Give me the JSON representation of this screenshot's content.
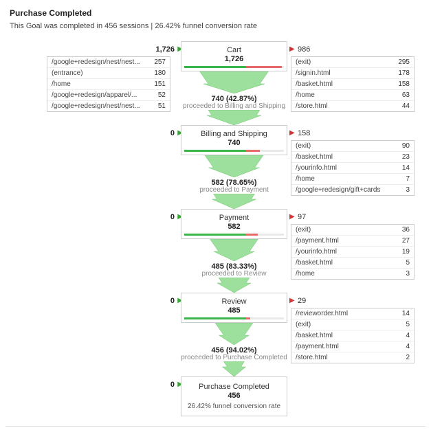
{
  "header": {
    "title": "Purchase Completed",
    "subtitle": "This Goal was completed in 456 sessions | 26.42% funnel conversion rate"
  },
  "steps": [
    {
      "name": "Cart",
      "count": "1,726",
      "in_count": "1,726",
      "out_count": "986",
      "bar_green_pct": 62,
      "bar_red_pct": 36,
      "proceeded_count": "740 (42.87%)",
      "proceeded_label": "proceeded to Billing and Shipping",
      "in_rows": [
        {
          "path": "/google+redesign/nest/nest...",
          "n": "257"
        },
        {
          "path": "(entrance)",
          "n": "180"
        },
        {
          "path": "/home",
          "n": "151"
        },
        {
          "path": "/google+redesign/apparel/...",
          "n": "52"
        },
        {
          "path": "/google+redesign/nest/nest...",
          "n": "51"
        }
      ],
      "out_rows": [
        {
          "path": "(exit)",
          "n": "295"
        },
        {
          "path": "/signin.html",
          "n": "178"
        },
        {
          "path": "/basket.html",
          "n": "158"
        },
        {
          "path": "/home",
          "n": "63"
        },
        {
          "path": "/store.html",
          "n": "44"
        }
      ]
    },
    {
      "name": "Billing and Shipping",
      "count": "740",
      "in_count": "0",
      "out_count": "158",
      "bar_green_pct": 62,
      "bar_red_pct": 14,
      "proceeded_count": "582 (78.65%)",
      "proceeded_label": "proceeded to Payment",
      "in_rows": [],
      "out_rows": [
        {
          "path": "(exit)",
          "n": "90"
        },
        {
          "path": "/basket.html",
          "n": "23"
        },
        {
          "path": "/yourinfo.html",
          "n": "14"
        },
        {
          "path": "/home",
          "n": "7"
        },
        {
          "path": "/google+redesign/gift+cards",
          "n": "3"
        }
      ]
    },
    {
      "name": "Payment",
      "count": "582",
      "in_count": "0",
      "out_count": "97",
      "bar_green_pct": 62,
      "bar_red_pct": 12,
      "proceeded_count": "485 (83.33%)",
      "proceeded_label": "proceeded to Review",
      "in_rows": [],
      "out_rows": [
        {
          "path": "(exit)",
          "n": "36"
        },
        {
          "path": "/payment.html",
          "n": "27"
        },
        {
          "path": "/yourinfo.html",
          "n": "19"
        },
        {
          "path": "/basket.html",
          "n": "5"
        },
        {
          "path": "/home",
          "n": "3"
        }
      ]
    },
    {
      "name": "Review",
      "count": "485",
      "in_count": "0",
      "out_count": "29",
      "bar_green_pct": 62,
      "bar_red_pct": 4,
      "proceeded_count": "456 (94.02%)",
      "proceeded_label": "proceeded to Purchase Completed",
      "in_rows": [],
      "out_rows": [
        {
          "path": "/revieworder.html",
          "n": "14"
        },
        {
          "path": "(exit)",
          "n": "5"
        },
        {
          "path": "/basket.html",
          "n": "4"
        },
        {
          "path": "/payment.html",
          "n": "4"
        },
        {
          "path": "/store.html",
          "n": "2"
        }
      ]
    }
  ],
  "final": {
    "name": "Purchase Completed",
    "count": "456",
    "in_count": "0",
    "conversion": "26.42% funnel conversion rate"
  }
}
